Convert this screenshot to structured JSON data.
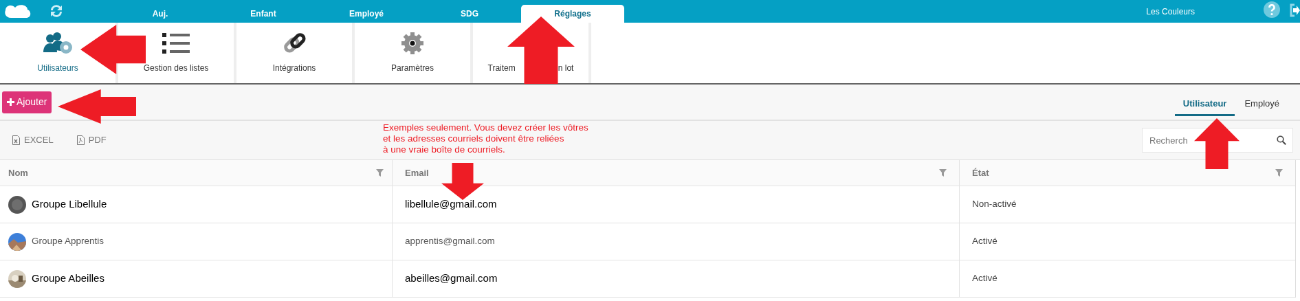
{
  "top_tabs": [
    {
      "label": "Auj.",
      "selected": false
    },
    {
      "label": "Enfant",
      "selected": false
    },
    {
      "label": "Employé",
      "selected": false
    },
    {
      "label": "SDG",
      "selected": false
    },
    {
      "label": "Réglages",
      "selected": true
    }
  ],
  "account_name": "Les Couleurs",
  "ribbon": [
    {
      "kind": "users",
      "label_parts": [
        "Utilisateurs"
      ],
      "selected": true
    },
    {
      "kind": "list",
      "label_parts": [
        "Gestion des listes"
      ],
      "selected": false
    },
    {
      "kind": "link",
      "label_parts": [
        "Intégrations"
      ],
      "selected": false
    },
    {
      "kind": "gear",
      "label_parts": [
        "Paramètres"
      ],
      "selected": false
    },
    {
      "kind": "batch",
      "label_parts": [
        "Traitem",
        "n lot"
      ],
      "selected": false
    }
  ],
  "add_button": "Ajouter",
  "view_tabs": [
    {
      "label": "Utilisateur",
      "selected": true
    },
    {
      "label": "Employé",
      "selected": false
    }
  ],
  "exports": [
    {
      "kind": "excel",
      "label": "EXCEL"
    },
    {
      "kind": "pdf",
      "label": "PDF"
    }
  ],
  "note": [
    "Exemples seulement. Vous devez créer les vôtres",
    "et les adresses courriels doivent être reliées",
    "à une vraie boîte de courriels."
  ],
  "search": {
    "placeholder": "Recherch"
  },
  "table": {
    "columns": [
      "Nom",
      "Email",
      "État"
    ],
    "rows": [
      {
        "avatar": {
          "kind": "default"
        },
        "name": "Groupe Libellule",
        "email": "libellule@gmail.com",
        "state": "Non-activé",
        "emphasized": true
      },
      {
        "name": "Groupe Apprentis",
        "email": "apprentis@gmail.com",
        "state": "Activé",
        "emphasized": false
      },
      {
        "name": "Groupe Abeilles",
        "email": "abeilles@gmail.com",
        "state": "Activé",
        "emphasized": true
      }
    ]
  }
}
